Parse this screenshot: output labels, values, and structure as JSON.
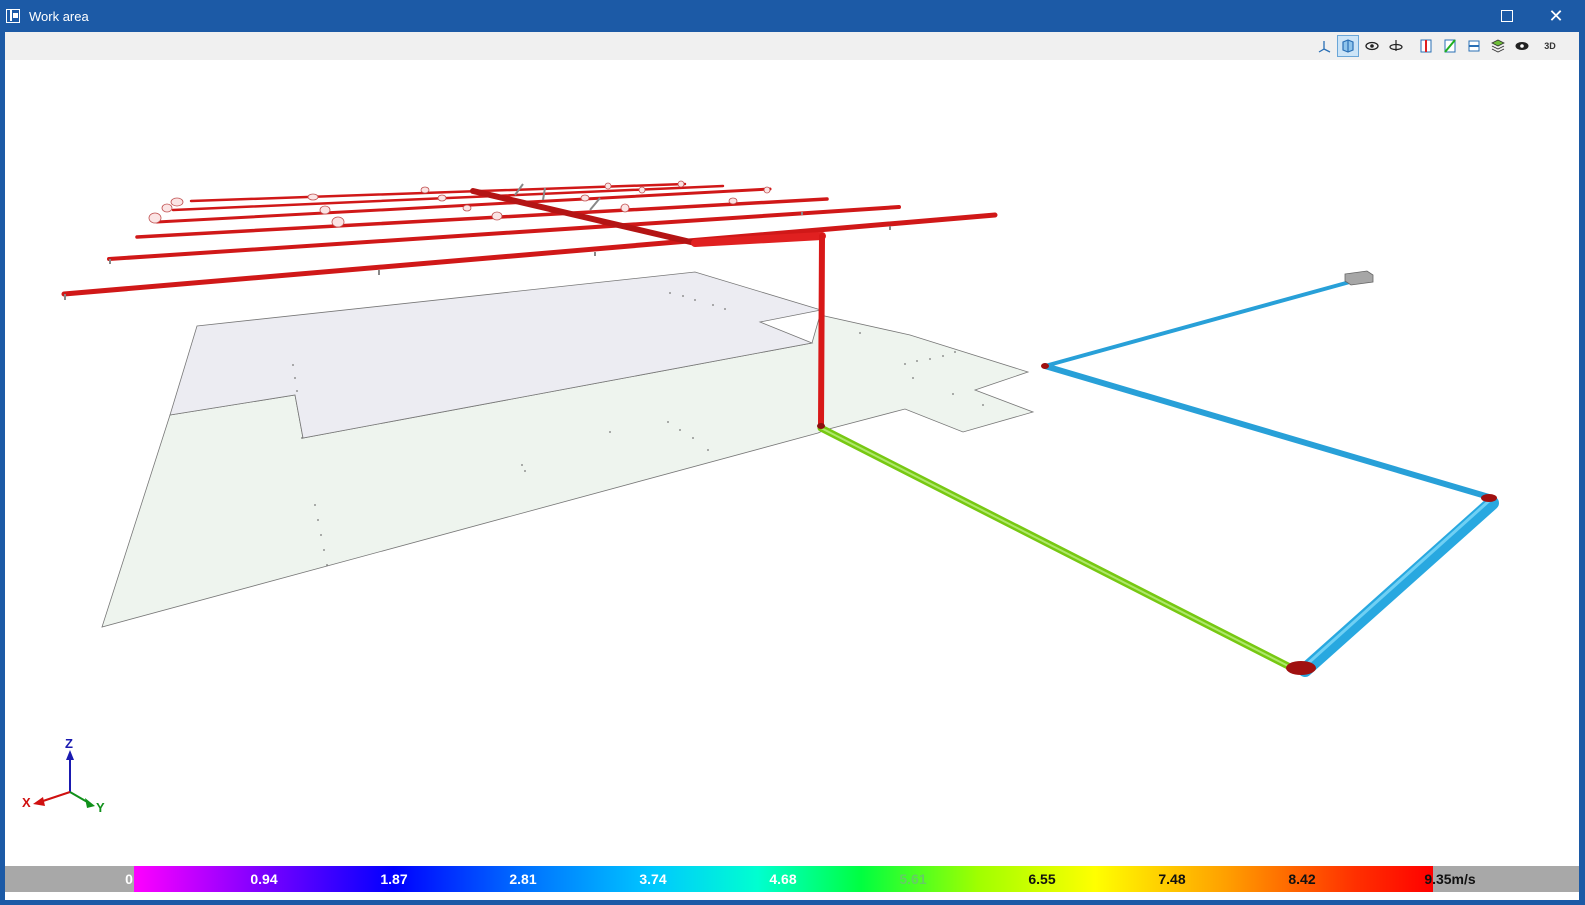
{
  "window": {
    "title": "Work area"
  },
  "toolbar": {
    "buttons": [
      "axes-view",
      "solid-view",
      "hide-elements",
      "orbit",
      "section-x",
      "section-y",
      "section-z",
      "layers",
      "visibility",
      "view-3d"
    ],
    "view_3d_label": "3D"
  },
  "colors": {
    "titlebar": "#1c5aa6",
    "pipe_high_velocity": "#e01818",
    "pipe_medium_velocity": "#7ccc10",
    "pipe_low_velocity": "#28a8e0",
    "floor_slab": "#eef2ee"
  },
  "axes": {
    "x": "X",
    "y": "Y",
    "z": "Z"
  },
  "legend": {
    "labels": [
      "0",
      "0.94",
      "1.87",
      "2.81",
      "3.74",
      "4.68",
      "5.61",
      "6.55",
      "7.48",
      "8.42",
      "9.35m/s"
    ]
  }
}
